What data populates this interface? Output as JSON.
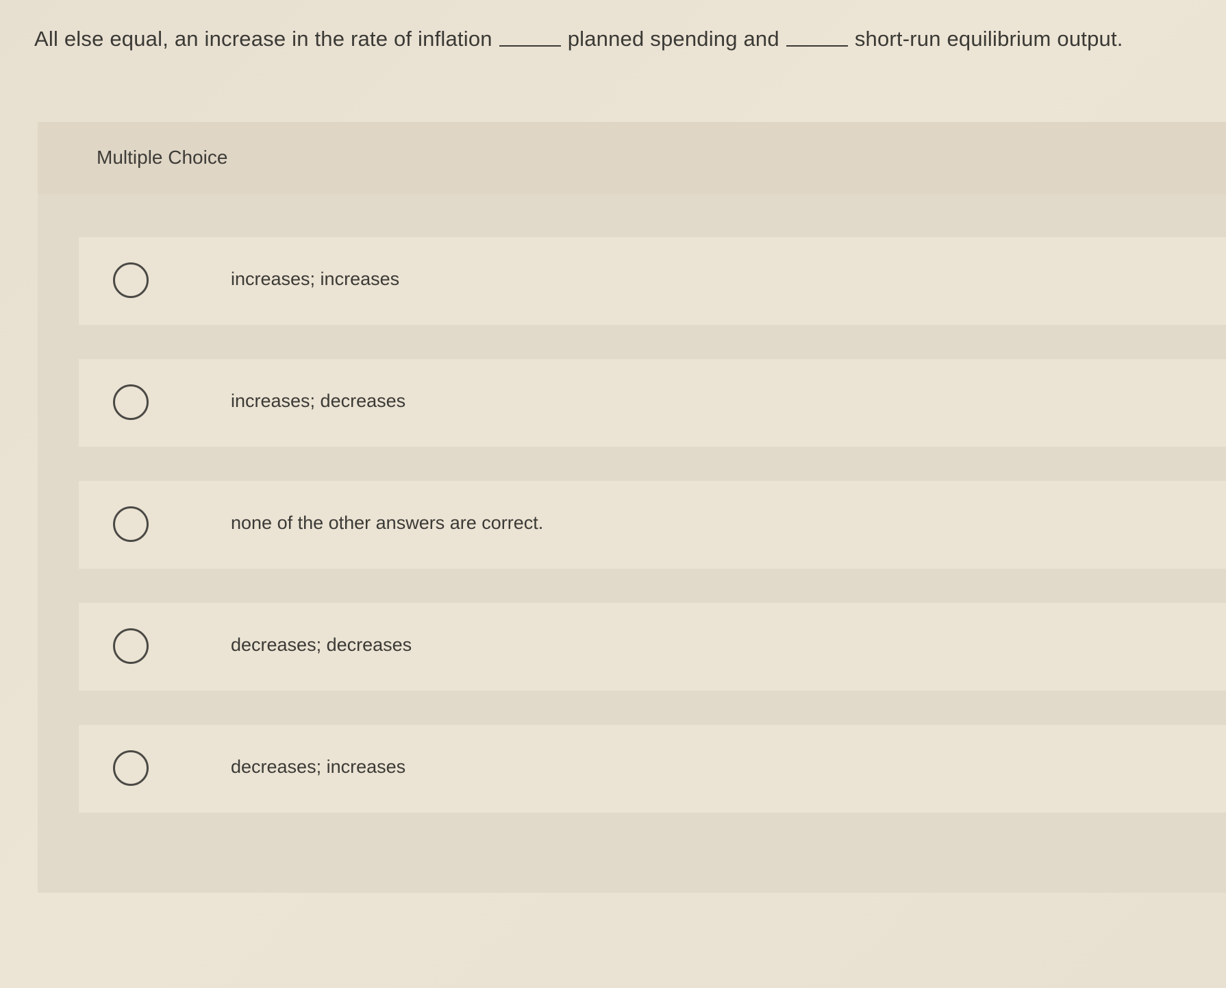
{
  "question": {
    "part1": "All else equal, an increase in the rate of inflation",
    "part2": "planned spending and",
    "part3": "short-run equilibrium output."
  },
  "panel": {
    "title": "Multiple Choice"
  },
  "choices": [
    {
      "label": "increases; increases"
    },
    {
      "label": "increases; decreases"
    },
    {
      "label": "none of the other answers are correct."
    },
    {
      "label": "decreases; decreases"
    },
    {
      "label": "decreases; increases"
    }
  ]
}
